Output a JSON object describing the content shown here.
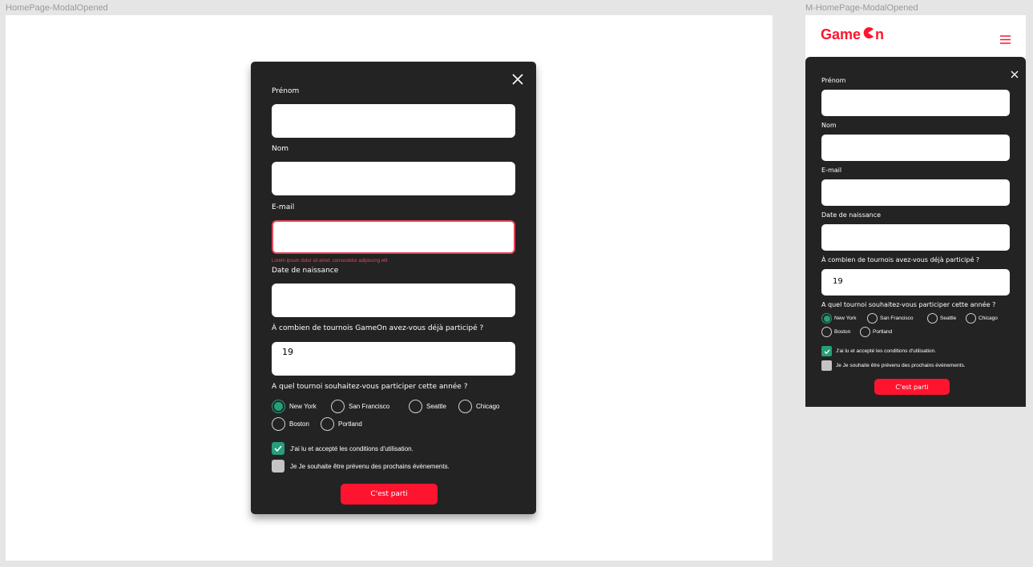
{
  "colors": {
    "canvas": "#e5e5e5",
    "modal_bg": "#232323",
    "accent_red": "#fe142f",
    "error_red": "#e54858",
    "check_green": "#279e7a"
  },
  "desktop": {
    "frame_label": "HomePage-ModalOpened",
    "close_icon": "close-icon",
    "fields": {
      "first_name_label": "Prénom",
      "last_name_label": "Nom",
      "email_label": "E-mail",
      "email_error": "Lorem ipsum dolor sit amet, consectetur adipiscing elit",
      "birthdate_label": "Date de naissance",
      "quantity_label": "À combien de tournois GameOn avez-vous déjà participé ?",
      "quantity_value": "19"
    },
    "location_label": "A quel tournoi souhaitez-vous participer cette année ?",
    "locations": [
      {
        "label": "New York",
        "checked": true
      },
      {
        "label": "San Francisco",
        "checked": false
      },
      {
        "label": "Seattle",
        "checked": false
      },
      {
        "label": "Chicago",
        "checked": false
      },
      {
        "label": "Boston",
        "checked": false
      },
      {
        "label": "Portland",
        "checked": false
      }
    ],
    "checkboxes": [
      {
        "label": "J'ai lu et accepté les conditions d'utilisation.",
        "checked": true
      },
      {
        "label": "Je Je souhaite être prévenu des prochains évènements.",
        "checked": false
      }
    ],
    "submit_label": "C'est parti"
  },
  "mobile": {
    "frame_label": "M-HomePage-ModalOpened",
    "logo_left": "Game",
    "logo_right": "n",
    "menu_icon": "hamburger-icon",
    "close_icon": "close-icon",
    "fields": {
      "first_name_label": "Prénom",
      "last_name_label": "Nom",
      "email_label": "E-mail",
      "birthdate_label": "Date de naissance",
      "quantity_label": "À combien de tournois avez-vous déjà participé ?",
      "quantity_value": "19"
    },
    "location_label": "A quel tournoi souhaitez-vous participer cette année ?",
    "locations": [
      {
        "label": "New York",
        "checked": true
      },
      {
        "label": "San Francisco",
        "checked": false
      },
      {
        "label": "Seattle",
        "checked": false
      },
      {
        "label": "Chicago",
        "checked": false
      },
      {
        "label": "Boston",
        "checked": false
      },
      {
        "label": "Portland",
        "checked": false
      }
    ],
    "checkboxes": [
      {
        "label": "J'ai lu et accepté les conditions d'utilisation.",
        "checked": true
      },
      {
        "label": "Je Je souhaite être prévenu des prochains évènements.",
        "checked": false
      }
    ],
    "submit_label": "C'est parti"
  }
}
